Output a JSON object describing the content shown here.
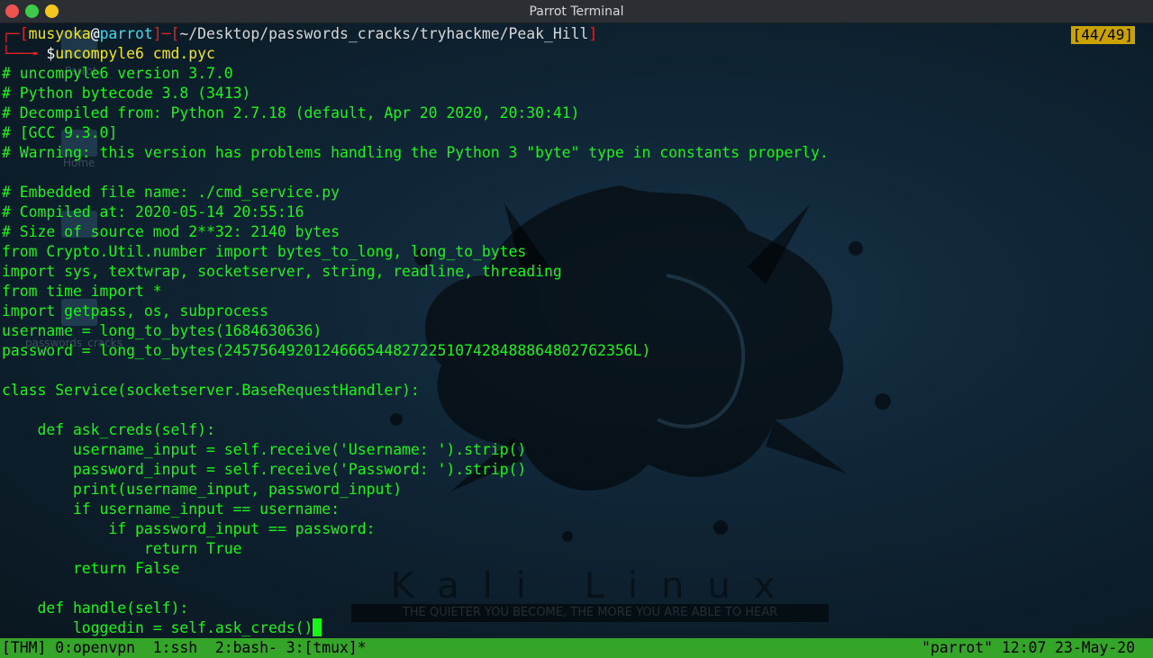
{
  "window": {
    "title": "Parrot Terminal"
  },
  "terminal": {
    "prompt": {
      "bracket_open": "┌─[",
      "user": "musyoka",
      "at": "@",
      "host": "parrot",
      "sep": "]─[",
      "path": "~/Desktop/passwords_cracks/tryhackme/Peak_Hill",
      "bracket_close": "]",
      "arrow": "└──╼ ",
      "dollar": "$",
      "command": "uncompyle6 cmd.pyc"
    },
    "scroll_counter": "[44/49]",
    "output": [
      "# uncompyle6 version 3.7.0",
      "# Python bytecode 3.8 (3413)",
      "# Decompiled from: Python 2.7.18 (default, Apr 20 2020, 20:30:41)",
      "# [GCC 9.3.0]",
      "# Warning: this version has problems handling the Python 3 \"byte\" type in constants properly.",
      "",
      "# Embedded file name: ./cmd_service.py",
      "# Compiled at: 2020-05-14 20:55:16",
      "# Size of source mod 2**32: 2140 bytes",
      "from Crypto.Util.number import bytes_to_long, long_to_bytes",
      "import sys, textwrap, socketserver, string, readline, threading",
      "from time import *",
      "import getpass, os, subprocess",
      "username = long_to_bytes(1684630636)",
      "password = long_to_bytes(2457564920124666544827225107428488864802762356L)",
      "",
      "class Service(socketserver.BaseRequestHandler):",
      "",
      "    def ask_creds(self):",
      "        username_input = self.receive('Username: ').strip()",
      "        password_input = self.receive('Password: ').strip()",
      "        print(username_input, password_input)",
      "        if username_input == username:",
      "            if password_input == password:",
      "                return True",
      "        return False",
      "",
      "    def handle(self):",
      "        loggedin = self.ask_creds()"
    ]
  },
  "background": {
    "desktop_labels": [
      "Home",
      "passwords_cracks",
      "Parrot"
    ],
    "kali_word": "Kali Linux",
    "kali_slogan": "THE QUIETER YOU BECOME, THE MORE YOU ARE ABLE TO HEAR"
  },
  "tmux": {
    "left": "[THM] 0:openvpn  1:ssh  2:bash- 3:[tmux]*",
    "right": "\"parrot\" 12:07 23-May-20"
  },
  "colors": {
    "code_text": "#19f719",
    "status_bar": "#35a52a",
    "counter_bg": "#c9a100"
  }
}
